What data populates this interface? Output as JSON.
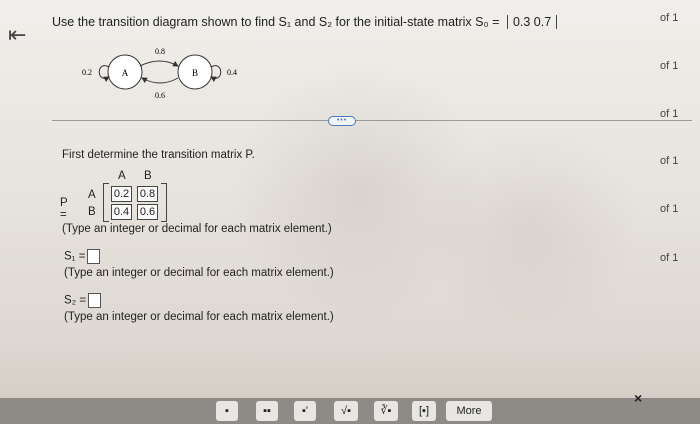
{
  "question": {
    "text": "Use the transition diagram shown to find S₁ and S₂ for the initial-state matrix S₀ = ",
    "s0_values": "0.3  0.7"
  },
  "diagram": {
    "state_a": "A",
    "state_b": "B",
    "loop_a": "0.2",
    "loop_b": "0.4",
    "a_to_b": "0.8",
    "b_to_a": "0.6"
  },
  "step1": {
    "instruction": "First determine the transition matrix P.",
    "p_label": "P =",
    "col_a": "A",
    "col_b": "B",
    "row_a": "A",
    "row_b": "B",
    "cells": [
      "0.2",
      "0.8",
      "0.4",
      "0.6"
    ],
    "hint": "(Type an integer or decimal for each matrix element.)"
  },
  "s1": {
    "label": "S₁ =",
    "hint": "(Type an integer or decimal for each matrix element.)"
  },
  "s2": {
    "label": "S₂ =",
    "hint": "(Type an integer or decimal for each matrix element.)"
  },
  "divider_dots": "•••",
  "right_column": [
    "of 1",
    "of 1",
    "of 1",
    "of 1",
    "of 1",
    "of 1"
  ],
  "toolbar": {
    "more_label": "More",
    "close_label": "×"
  }
}
